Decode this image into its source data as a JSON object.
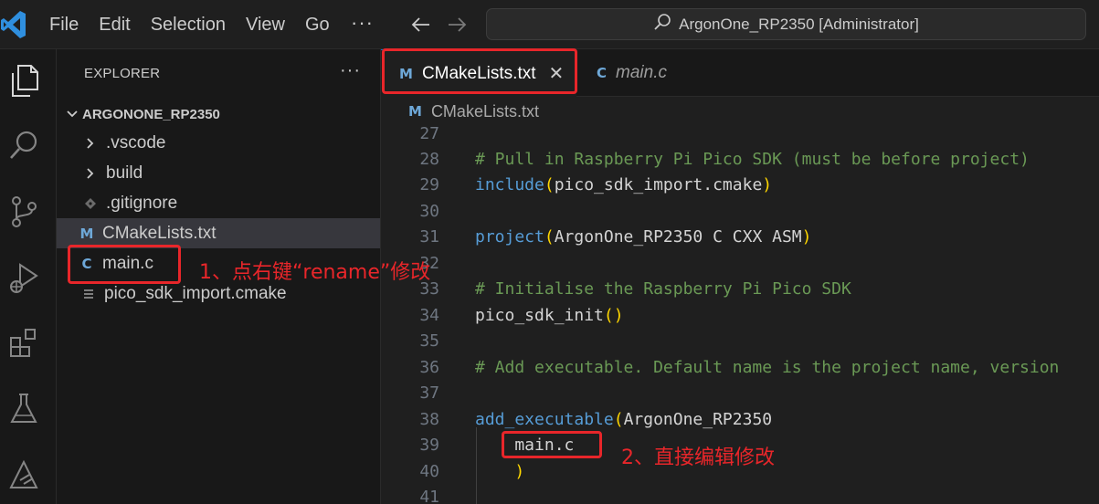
{
  "window": {
    "title": "ArgonOne_RP2350 [Administrator]"
  },
  "menu": {
    "file": "File",
    "edit": "Edit",
    "selection": "Selection",
    "view": "View",
    "go": "Go",
    "more": "···"
  },
  "sidebar": {
    "title": "EXPLORER",
    "more": "···",
    "root_folder": "ARGONONE_RP2350",
    "items": [
      {
        "label": ".vscode",
        "icon": "chevron-right-icon",
        "glyph": "›"
      },
      {
        "label": "build",
        "icon": "chevron-right-icon",
        "glyph": "›"
      },
      {
        "label": ".gitignore",
        "icon": "git-icon",
        "glyph": "◆"
      },
      {
        "label": "CMakeLists.txt",
        "icon": "cmake-file-icon",
        "glyph": "M"
      },
      {
        "label": "main.c",
        "icon": "c-file-icon",
        "glyph": "C"
      },
      {
        "label": "pico_sdk_import.cmake",
        "icon": "list-file-icon",
        "glyph": "≡"
      }
    ]
  },
  "tabs": [
    {
      "label": "CMakeLists.txt",
      "icon_glyph": "M",
      "active": true,
      "close": "✕"
    },
    {
      "label": "main.c",
      "icon_glyph": "C",
      "active": false
    }
  ],
  "breadcrumb": {
    "icon_glyph": "M",
    "label": "CMakeLists.txt"
  },
  "code_lines": [
    {
      "num": "27",
      "text": ""
    },
    {
      "num": "28",
      "text": "# Pull in Raspberry Pi Pico SDK (must be before project)"
    },
    {
      "num": "29",
      "fn": "include",
      "args": "pico_sdk_import.cmake"
    },
    {
      "num": "30",
      "text": ""
    },
    {
      "num": "31",
      "fn": "project",
      "args": "ArgonOne_RP2350 C CXX ASM"
    },
    {
      "num": "32",
      "text": ""
    },
    {
      "num": "33",
      "text": "# Initialise the Raspberry Pi Pico SDK"
    },
    {
      "num": "34",
      "fn": "pico_sdk_init",
      "args": ""
    },
    {
      "num": "35",
      "text": ""
    },
    {
      "num": "36",
      "text": "# Add executable. Default name is the project name, version"
    },
    {
      "num": "37",
      "text": ""
    },
    {
      "num": "38",
      "fn": "add_executable",
      "args": "ArgonOne_RP2350"
    },
    {
      "num": "39",
      "text": "    main.c"
    },
    {
      "num": "40",
      "text": "    )"
    },
    {
      "num": "41",
      "text": ""
    }
  ],
  "annotations": {
    "step1": "1、点右键“rename”修改",
    "step2": "2、直接编辑修改"
  },
  "colors": {
    "accent": "#0078d4",
    "annotation_red": "#e8262a",
    "comment": "#6a9955",
    "keyword_fn": "#569cd6",
    "paren": "#ffd700"
  }
}
